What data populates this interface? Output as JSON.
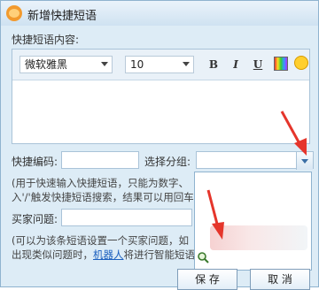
{
  "window": {
    "title": "新增快捷短语"
  },
  "content_label": "快捷短语内容:",
  "toolbar": {
    "font": "微软雅黑",
    "size": "10",
    "bold": "B",
    "italic": "I",
    "underline": "U"
  },
  "code_label": "快捷编码:",
  "group_label": "选择分组:",
  "code_help_line1": "(用于快速输入快捷短语，只能为数字、",
  "code_help_line2": "入'/'触发快捷短语搜索，结果可以用回车",
  "buyer_label": "买家问题:",
  "buyer_help_line1": "(可以为该条短语设置一个买家问题，如",
  "buyer_help_line2_pre": "出现类似问题时，",
  "buyer_help_link": "机器人",
  "buyer_help_line2_post": "将进行智能短语",
  "buttons": {
    "save": "保 存",
    "cancel": "取 消"
  },
  "colors": {
    "annotation_arrow": "#e5352b",
    "link": "#1b5fbf"
  },
  "icons": [
    "app-logo-icon",
    "text-color-icon",
    "emoji-icon",
    "search-icon",
    "chevron-down-icon"
  ]
}
